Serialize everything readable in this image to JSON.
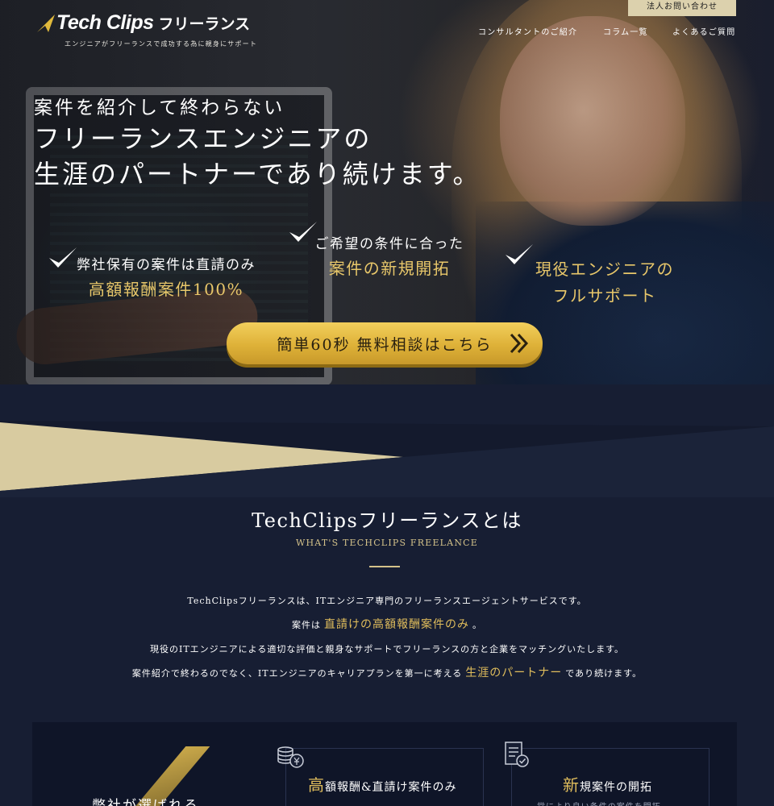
{
  "header": {
    "logo_text": "Tech Clips",
    "logo_kana": "フリーランス",
    "tagline": "エンジニアがフリーランスで成功する為に親身にサポート",
    "corp_contact": "法人お問い合わせ",
    "nav": [
      "コンサルタントのご紹介",
      "コラム一覧",
      "よくあるご質問"
    ]
  },
  "hero": {
    "sub": "案件を紹介して終わらない",
    "main_line1": "フリーランスエンジニアの",
    "main_line2": "生涯のパートナーであり続けます。",
    "features": [
      {
        "l1": "弊社保有の案件は直請のみ",
        "l2": "高額報酬案件100%"
      },
      {
        "l1": "ご希望の条件に合った",
        "l2": "案件の新規開拓"
      },
      {
        "l1": "現役エンジニアの",
        "l2": "フルサポート"
      }
    ],
    "cta": "簡単60秒 無料相談はこちら"
  },
  "about": {
    "title": "TechClipsフリーランスとは",
    "title_en": "WHAT'S TECHCLIPS FREELANCE",
    "p1": "TechClipsフリーランスは、ITエンジニア専門のフリーランスエージェントサービスです。",
    "p2_pre": "案件は",
    "p2_hl": "直請けの高額報酬案件のみ",
    "p2_post": "。",
    "p3": "現役のITエンジニアによる適切な評価と親身なサポートでフリーランスの方と企業をマッチングいたします。",
    "p4_pre": "案件紹介で終わるのでなく、ITエンジニアのキャリアプランを第一に考える",
    "p4_hl": "生涯のパートナー",
    "p4_post": "であり続けます。"
  },
  "reasons": {
    "question": "弊社が選ばれる",
    "cards": [
      {
        "big": "高",
        "rest": "額報酬&直請け案件のみ",
        "icon": "coins-yen-icon",
        "sub": ""
      },
      {
        "big": "新",
        "rest": "規案件の開拓",
        "icon": "document-check-icon",
        "sub": "常により良い条件の案件を開拓"
      }
    ]
  },
  "colors": {
    "gold": "#e0bd5c",
    "navy": "#171e33",
    "cta": "#deb138",
    "beige": "#dcd1ad"
  }
}
